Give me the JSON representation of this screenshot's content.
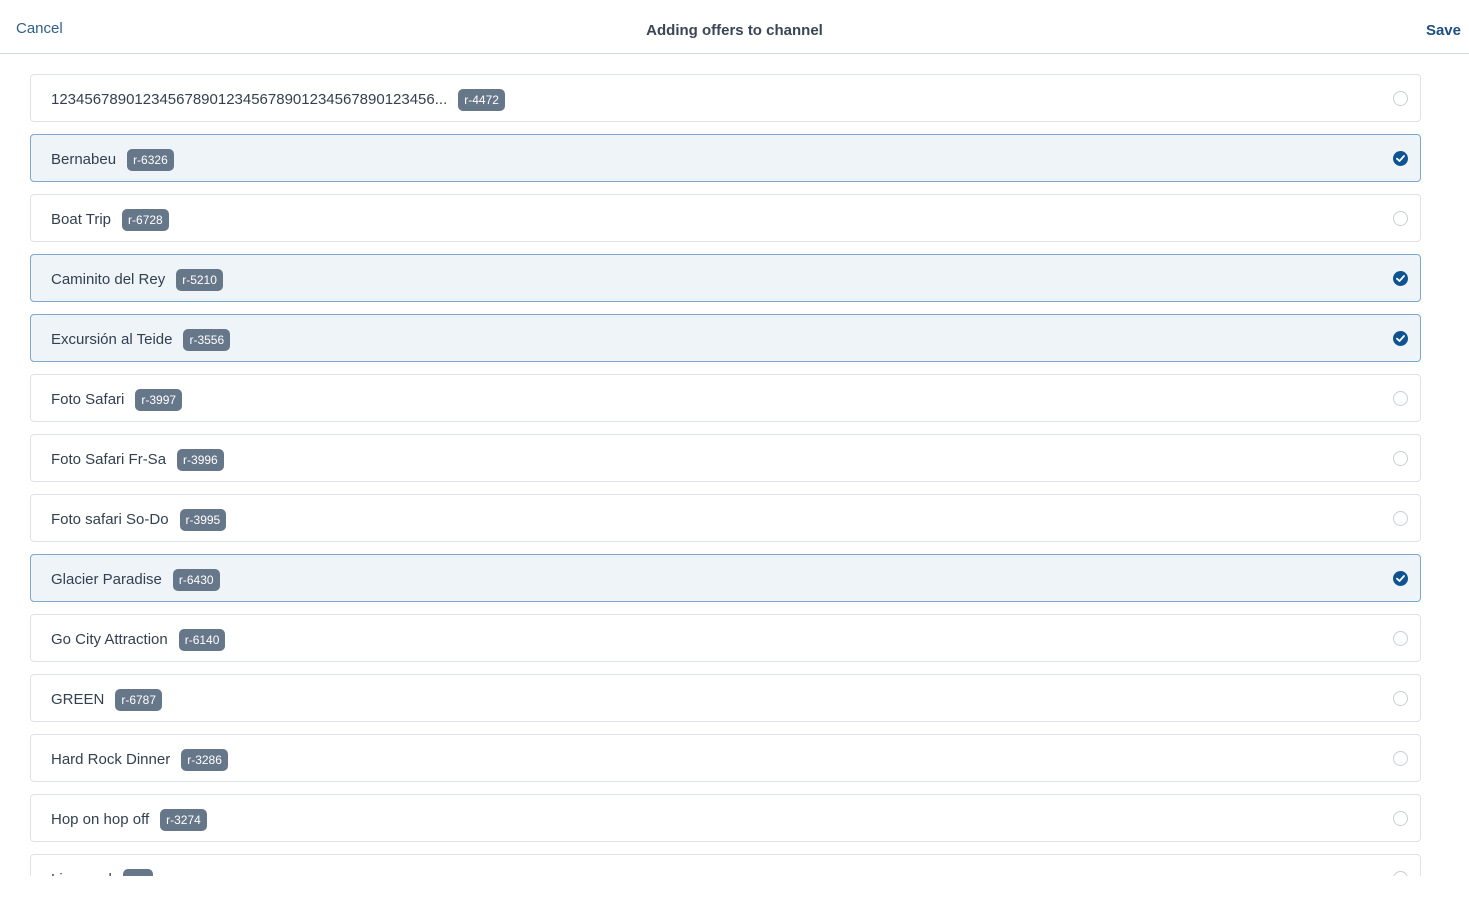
{
  "header": {
    "cancel_label": "Cancel",
    "title": "Adding offers to channel",
    "save_label": "Save"
  },
  "colors": {
    "accent": "#0f5492",
    "badge": "#67778a",
    "selected_row_bg": "#eff4f9"
  },
  "offers": [
    {
      "name": "1234567890123456789012345678901234567890123456...",
      "code": "r-4472",
      "selected": false
    },
    {
      "name": "Bernabeu",
      "code": "r-6326",
      "selected": true
    },
    {
      "name": "Boat Trip",
      "code": "r-6728",
      "selected": false
    },
    {
      "name": "Caminito del Rey",
      "code": "r-5210",
      "selected": true
    },
    {
      "name": "Excursión al Teide",
      "code": "r-3556",
      "selected": true
    },
    {
      "name": "Foto Safari",
      "code": "r-3997",
      "selected": false
    },
    {
      "name": "Foto Safari Fr-Sa",
      "code": "r-3996",
      "selected": false
    },
    {
      "name": "Foto safari So-Do",
      "code": "r-3995",
      "selected": false
    },
    {
      "name": "Glacier Paradise",
      "code": "r-6430",
      "selected": true
    },
    {
      "name": "Go City Attraction",
      "code": "r-6140",
      "selected": false
    },
    {
      "name": "GREEN",
      "code": "r-6787",
      "selected": false
    },
    {
      "name": "Hard Rock Dinner",
      "code": "r-3286",
      "selected": false
    },
    {
      "name": "Hop on hop off",
      "code": "r-3274",
      "selected": false
    },
    {
      "name": "Liverpool",
      "code": "r-...",
      "selected": false
    }
  ]
}
